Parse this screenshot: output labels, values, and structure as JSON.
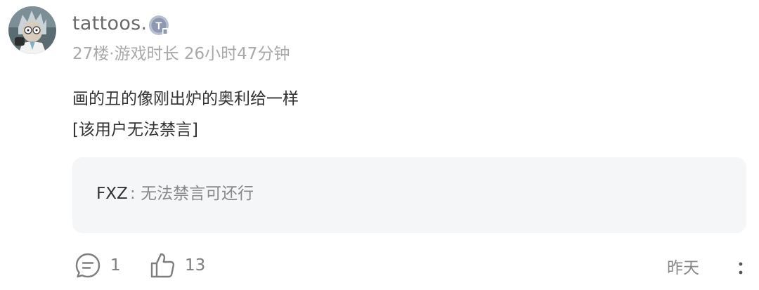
{
  "comment": {
    "username": "tattoos.",
    "level_badge": "T",
    "floor": "27楼",
    "separator": "·",
    "playtime": "游戏时长 26小时47分钟",
    "content_lines": [
      "画的丑的像刚出炉的奥利给一样",
      "[该用户无法禁言]"
    ],
    "reply": {
      "author": "FXZ",
      "separator": ":",
      "text": "无法禁言可还行"
    },
    "actions": {
      "reply_count": "1",
      "like_count": "13"
    },
    "time": "昨天"
  },
  "icons": {
    "avatar": "cartoon-scientist-avatar",
    "badge": "level-t-badge-icon",
    "reply": "comment-bubble-icon",
    "like": "thumbs-up-icon",
    "more": "more-vertical-icon"
  },
  "colors": {
    "username": "#6a6a6a",
    "meta": "#a9a9a9",
    "text": "#333333",
    "reply_bg": "#f5f6f8",
    "icon": "#7d7d7d"
  }
}
